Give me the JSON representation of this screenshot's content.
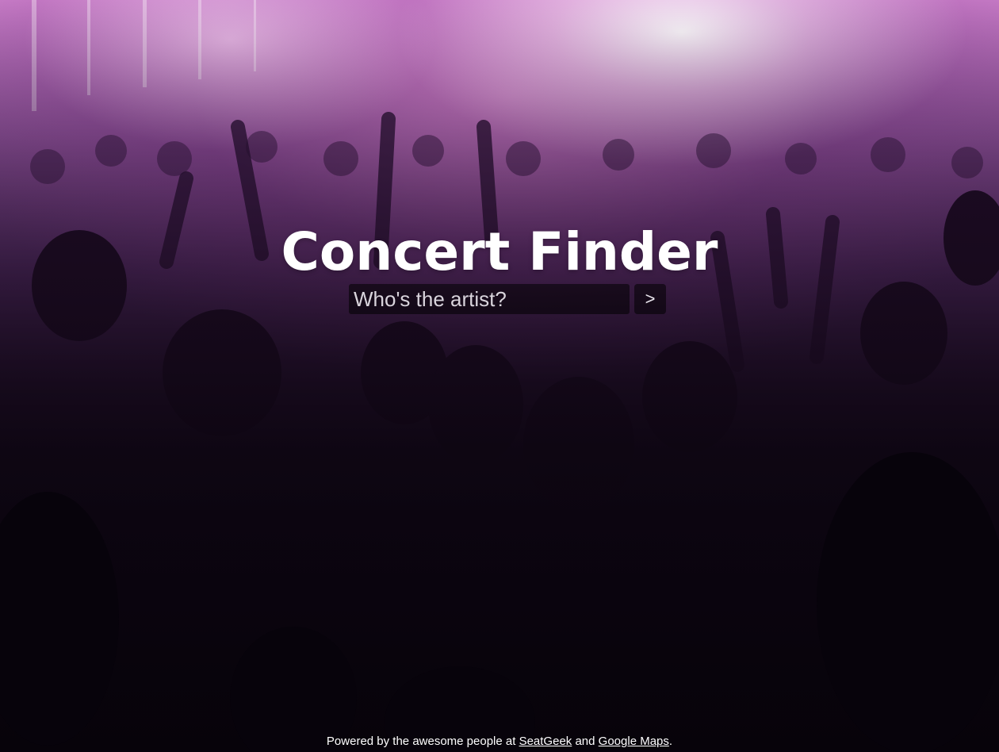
{
  "hero": {
    "title": "Concert Finder",
    "search_placeholder": "Who's the artist?",
    "search_value": "",
    "submit_label": ">"
  },
  "footer": {
    "prefix": "Powered by the awesome people at ",
    "link1_label": "SeatGeek",
    "middle": " and ",
    "link2_label": "Google Maps",
    "suffix": "."
  },
  "background": {
    "description_icon": "concert-crowd-photo",
    "accent_colors": [
      "#c77cc6",
      "#5c3170",
      "#0c0614"
    ]
  }
}
